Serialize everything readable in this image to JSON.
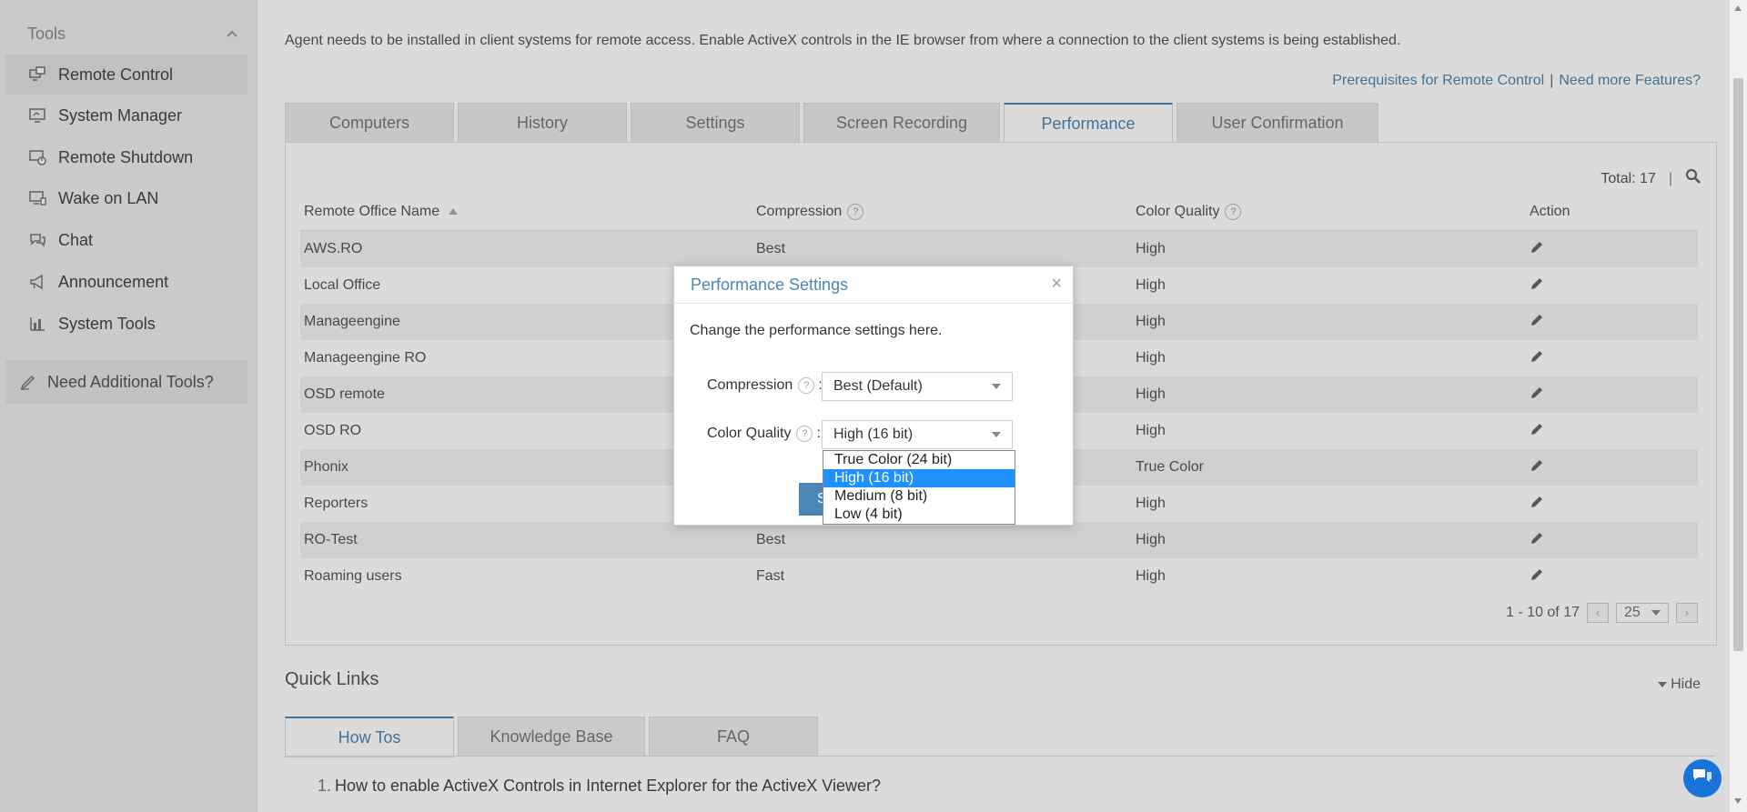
{
  "sidebar": {
    "header": "Tools",
    "items": [
      {
        "label": "Remote Control",
        "icon": "remote-control-icon",
        "active": true
      },
      {
        "label": "System Manager",
        "icon": "system-manager-icon"
      },
      {
        "label": "Remote Shutdown",
        "icon": "remote-shutdown-icon"
      },
      {
        "label": "Wake on LAN",
        "icon": "wake-on-lan-icon"
      },
      {
        "label": "Chat",
        "icon": "chat-icon"
      },
      {
        "label": "Announcement",
        "icon": "megaphone-icon"
      },
      {
        "label": "System Tools",
        "icon": "chart-icon"
      }
    ],
    "need_tools": "Need Additional Tools?"
  },
  "main": {
    "notice": "Agent needs to be installed in client systems for remote access. Enable ActiveX controls in the IE browser from where a connection to the client systems is being established.",
    "links": {
      "prerequisites": "Prerequisites for Remote Control",
      "separator": "|",
      "more_features": "Need more Features?"
    },
    "tabs": [
      "Computers",
      "History",
      "Settings",
      "Screen Recording",
      "Performance",
      "User Confirmation"
    ],
    "active_tab": "Performance",
    "total_label": "Total: 17",
    "total_separator": "|",
    "columns": [
      "Remote Office Name",
      "Compression",
      "Color Quality",
      "Action"
    ],
    "rows": [
      {
        "name": "AWS.RO",
        "compression": "Best",
        "color": "High"
      },
      {
        "name": "Local Office",
        "compression": "",
        "color": "High"
      },
      {
        "name": "Manageengine",
        "compression": "",
        "color": "High"
      },
      {
        "name": "Manageengine RO",
        "compression": "",
        "color": "High"
      },
      {
        "name": "OSD remote",
        "compression": "",
        "color": "High"
      },
      {
        "name": "OSD RO",
        "compression": "",
        "color": "High"
      },
      {
        "name": "Phonix",
        "compression": "",
        "color": "True Color"
      },
      {
        "name": "Reporters",
        "compression": "",
        "color": "High"
      },
      {
        "name": "RO-Test",
        "compression": "Best",
        "color": "High"
      },
      {
        "name": "Roaming users",
        "compression": "Fast",
        "color": "High"
      }
    ],
    "pager": {
      "range": "1 - 10 of 17",
      "page_size": "25"
    }
  },
  "quick_links": {
    "title": "Quick Links",
    "hide": "Hide",
    "tabs": [
      "How Tos",
      "Knowledge Base",
      "FAQ"
    ],
    "item_number": "1.",
    "first_item": "How to enable ActiveX Controls in Internet Explorer for the ActiveX Viewer?"
  },
  "dialog": {
    "title": "Performance Settings",
    "close": "×",
    "description": "Change the performance settings here.",
    "compression_label": "Compression",
    "compression_value": "Best (Default)",
    "color_label": "Color Quality",
    "color_value": "High (16 bit)",
    "colon": ":",
    "help": "?",
    "save_label": "S",
    "options": [
      "True Color (24 bit)",
      "High (16 bit)",
      "Medium (8 bit)",
      "Low (4 bit)"
    ],
    "selected_option": 1
  }
}
